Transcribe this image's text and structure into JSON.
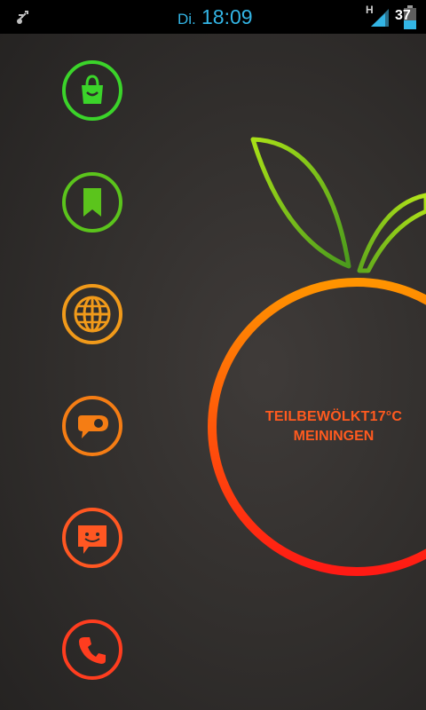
{
  "status_bar": {
    "day": "Di.",
    "time": "18:09",
    "network_type": "H",
    "battery_level": "37",
    "icons": [
      "usb-debug-icon",
      "signal-icon",
      "battery-icon"
    ]
  },
  "dock": {
    "items": [
      {
        "name": "shop-icon",
        "color": "#3bd42a"
      },
      {
        "name": "bookmark-icon",
        "color": "#5bc41c"
      },
      {
        "name": "globe-icon",
        "color": "#f19a1a"
      },
      {
        "name": "tag-icon",
        "color": "#f57d14"
      },
      {
        "name": "message-icon",
        "color": "#ff5722"
      },
      {
        "name": "phone-icon",
        "color": "#ff3d1f"
      }
    ]
  },
  "weather": {
    "condition": "TEILBEWÖLKT",
    "temperature": "17°C",
    "city": "MEININGEN"
  },
  "colors": {
    "leaf_start": "#4a9a1d",
    "leaf_end": "#a8e017",
    "ring_top": "#ff9400",
    "ring_bottom": "#ff1a14",
    "status_text": "#33b5e5"
  }
}
